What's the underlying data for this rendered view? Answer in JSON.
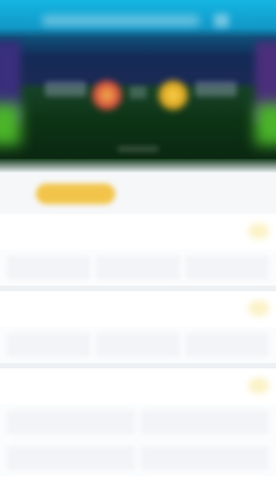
{
  "header": {
    "title": "",
    "teams": [
      {
        "name": ""
      },
      {
        "name": ""
      }
    ]
  },
  "tabs": [
    {
      "label": ""
    },
    {
      "label": ""
    },
    {
      "label": ""
    }
  ],
  "sections": [
    {
      "title": "",
      "odds": [
        {
          "label": "",
          "value": ""
        },
        {
          "label": "",
          "value": ""
        },
        {
          "label": "",
          "value": ""
        }
      ]
    },
    {
      "title": "",
      "odds": [
        {
          "label": "",
          "value": ""
        },
        {
          "label": "",
          "value": ""
        },
        {
          "label": "",
          "value": ""
        }
      ]
    },
    {
      "title": "",
      "odds": [
        {
          "label": "",
          "value": ""
        },
        {
          "label": "",
          "value": ""
        }
      ],
      "odds_second_row": [
        {
          "label": "",
          "value": ""
        },
        {
          "label": "",
          "value": ""
        }
      ]
    }
  ],
  "colors": {
    "accent": "#f2c54a",
    "header_top": "#14b6e3",
    "pitch": "#0d3315"
  }
}
